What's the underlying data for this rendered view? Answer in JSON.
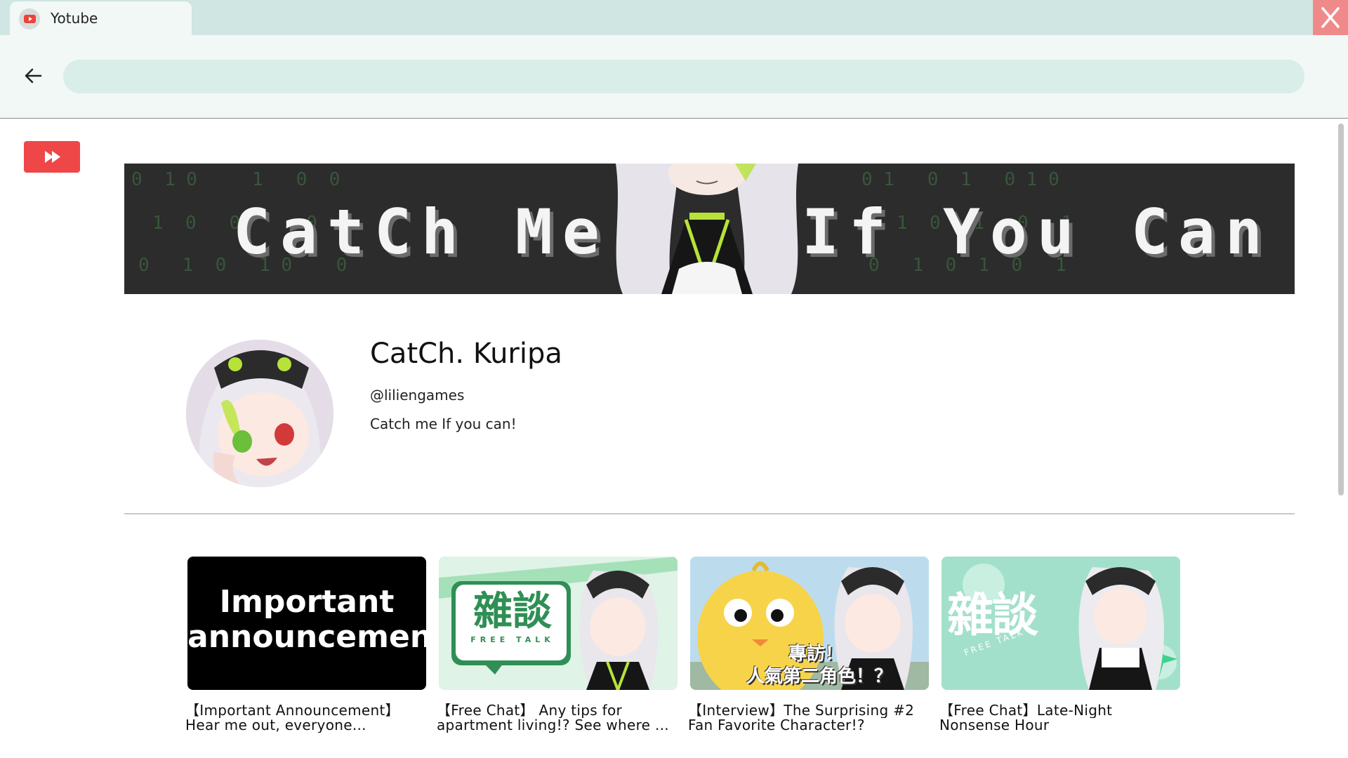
{
  "window": {
    "tab_title": "Yotube",
    "address": ""
  },
  "banner": {
    "text_left": "CatCh Me",
    "text_right": "If You Can"
  },
  "channel": {
    "name": "CatCh. Kuripa",
    "handle": "@liliengames",
    "description": "Catch me If you can!"
  },
  "videos": [
    {
      "thumb_text": "Important announcement",
      "title_line1": "【Important Announcement】",
      "title_line2": "Hear me out, everyone..."
    },
    {
      "thumb_text": "雜談",
      "thumb_subtext": "FREE TALK",
      "title_line1": "【Free Chat】 Any tips for",
      "title_line2": "apartment living!? See where ..."
    },
    {
      "thumb_text": "專訪！",
      "thumb_subtext": "人氣第二角色！？",
      "title_line1": "【Interview】The Surprising #2",
      "title_line2": "Fan Favorite Character!?"
    },
    {
      "thumb_text": "雜談",
      "thumb_subtext": "FREE TALK",
      "title_line1": "【Free Chat】Late-Night",
      "title_line2": "Nonsense Hour"
    }
  ],
  "colors": {
    "titlebar": "#cfe6e3",
    "close_button": "#f08a8a",
    "address_bar": "#d9ede9",
    "brand_red": "#ef4747",
    "banner_bg": "#2c2c2c",
    "accent_lime": "#b7e23a"
  },
  "icons": {
    "favicon": "youtube-favicon-icon",
    "close": "close-icon",
    "back": "arrow-left-icon",
    "logo": "fast-forward-icon"
  }
}
